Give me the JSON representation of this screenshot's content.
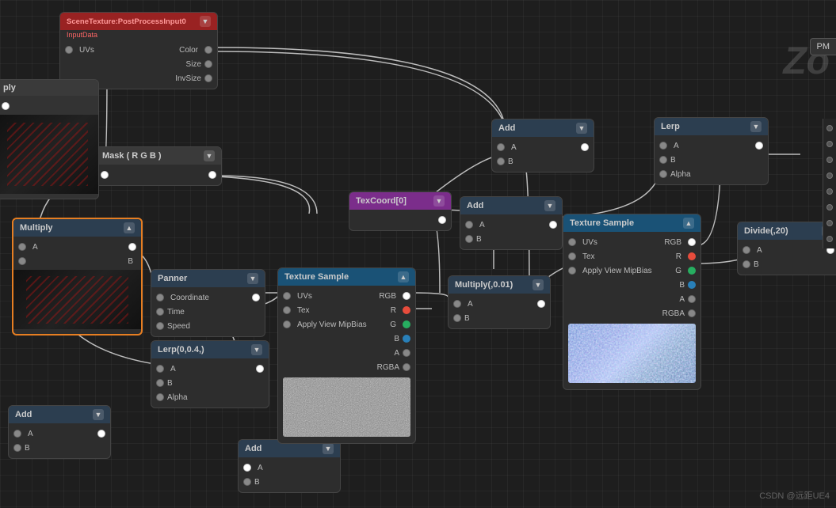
{
  "nodes": {
    "scene_texture": {
      "title": "SceneTexture:PostProcessInput0",
      "subtitle": "InputData",
      "outputs": [
        "Color",
        "Size",
        "InvSize"
      ],
      "inputs": [
        "UVs"
      ]
    },
    "mask": {
      "title": "Mask ( R G B )"
    },
    "multiply_big": {
      "title": "Multiply",
      "inputs": [
        "A",
        "B"
      ]
    },
    "panner": {
      "title": "Panner",
      "inputs": [
        "Coordinate",
        "Time",
        "Speed"
      ]
    },
    "lerp_bottom": {
      "title": "Lerp(0,0.4,)",
      "inputs": [
        "A",
        "B",
        "Alpha"
      ]
    },
    "add_bottom_left": {
      "title": "Add",
      "inputs": [
        "A",
        "B"
      ]
    },
    "texcoord": {
      "title": "TexCoord[0]"
    },
    "texture_sample_left": {
      "title": "Texture Sample",
      "inputs": [
        "UVs",
        "Tex",
        "Apply View MipBias"
      ],
      "outputs": [
        "RGB",
        "R",
        "G",
        "B",
        "A",
        "RGBA"
      ]
    },
    "texture_sample_right": {
      "title": "Texture Sample",
      "inputs": [
        "UVs",
        "Tex",
        "Apply View MipBias"
      ],
      "outputs": [
        "RGB",
        "R",
        "G",
        "B",
        "A",
        "RGBA"
      ]
    },
    "add_top": {
      "title": "Add",
      "inputs": [
        "A",
        "B"
      ]
    },
    "add_mid": {
      "title": "Add",
      "inputs": [
        "A",
        "B"
      ]
    },
    "multiply_small": {
      "title": "Multiply(,0.01)",
      "inputs": [
        "A",
        "B"
      ]
    },
    "lerp_top": {
      "title": "Lerp",
      "inputs": [
        "A",
        "B",
        "Alpha"
      ]
    },
    "divide": {
      "title": "Divide(,20)",
      "inputs": [
        "A",
        "B"
      ]
    },
    "add_bottom_mid": {
      "title": "Add",
      "inputs": [
        "A",
        "B"
      ]
    }
  },
  "watermark": "CSDN @远距UE4",
  "corner_label": "Zo",
  "pm_label": "PM"
}
